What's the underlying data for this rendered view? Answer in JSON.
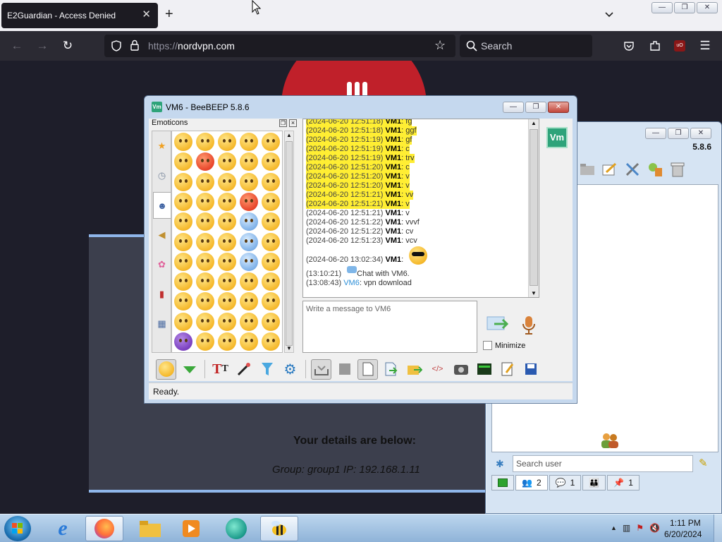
{
  "browser": {
    "tab_title": "E2Guardian - Access Denied",
    "tab_close": "✕",
    "new_tab": "+",
    "url_prefix": "https://",
    "url_host": "nordvpn.com",
    "search_placeholder": "Search"
  },
  "window_buttons": {
    "minimize": "—",
    "restore": "❐",
    "close": "✕"
  },
  "page": {
    "details_heading": "Your details are below:",
    "details_line": "Group: group1   IP: 192.168.1.11"
  },
  "chat": {
    "title": "VM6 - BeeBEEP 5.8.6",
    "app_icon": "Vm",
    "emoticons_label": "Emoticons",
    "messages": [
      {
        "ts": "(2024-06-20 12:51:18)",
        "who": "VM1",
        "text": "fg",
        "highlight": true
      },
      {
        "ts": "(2024-06-20 12:51:18)",
        "who": "VM1",
        "text": "ggf",
        "highlight": true
      },
      {
        "ts": "(2024-06-20 12:51:19)",
        "who": "VM1",
        "text": "gf",
        "highlight": true
      },
      {
        "ts": "(2024-06-20 12:51:19)",
        "who": "VM1",
        "text": "c",
        "highlight": true
      },
      {
        "ts": "(2024-06-20 12:51:19)",
        "who": "VM1",
        "text": "trv",
        "highlight": true
      },
      {
        "ts": "(2024-06-20 12:51:20)",
        "who": "VM1",
        "text": "c",
        "highlight": true
      },
      {
        "ts": "(2024-06-20 12:51:20)",
        "who": "VM1",
        "text": "v",
        "highlight": true
      },
      {
        "ts": "(2024-06-20 12:51:20)",
        "who": "VM1",
        "text": "v",
        "highlight": true
      },
      {
        "ts": "(2024-06-20 12:51:21)",
        "who": "VM1",
        "text": "vv",
        "highlight": true
      },
      {
        "ts": "(2024-06-20 12:51:21)",
        "who": "VM1",
        "text": "v",
        "highlight": true
      },
      {
        "ts": "(2024-06-20 12:51:21)",
        "who": "VM1",
        "text": "v",
        "highlight": false
      },
      {
        "ts": "(2024-06-20 12:51:22)",
        "who": "VM1",
        "text": "vvvf",
        "highlight": false
      },
      {
        "ts": "(2024-06-20 12:51:22)",
        "who": "VM1",
        "text": "cv",
        "highlight": false
      },
      {
        "ts": "(2024-06-20 12:51:23)",
        "who": "VM1",
        "text": "vcv",
        "highlight": false
      }
    ],
    "emoji_message": {
      "ts": "(2024-06-20 13:02:34)",
      "who": "VM1"
    },
    "system_line": {
      "ts": "(13:10:21)",
      "text": "Chat with VM6."
    },
    "last_message": {
      "ts": "(13:08:43)",
      "who": "VM6",
      "text": "vpn download"
    },
    "input_placeholder": "Write a message to VM6",
    "minimize_label": "Minimize",
    "status": "Ready.",
    "vm_badge": "Vm"
  },
  "main_window": {
    "version": "5.8.6",
    "search_placeholder": "Search user",
    "tabs": [
      {
        "icon": "users-icon",
        "count": "2"
      },
      {
        "icon": "chats-icon",
        "count": "1"
      },
      {
        "icon": "groups-icon",
        "count": ""
      },
      {
        "icon": "shares-icon",
        "count": "1"
      }
    ]
  },
  "taskbar": {
    "time": "1:11 PM",
    "date": "6/20/2024"
  },
  "colors": {
    "highlight": "#ffee33",
    "vm6_name": "#2c8fd8",
    "stop_red": "#c0202a",
    "card_border": "#8fb6ea"
  }
}
